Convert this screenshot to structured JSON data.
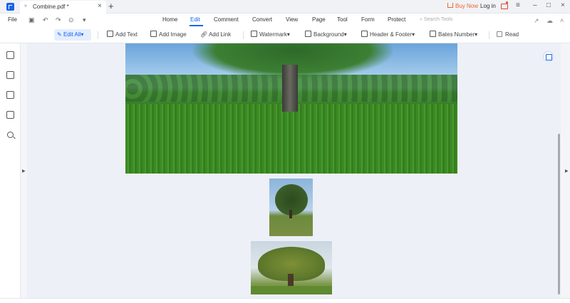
{
  "window": {
    "tab_title": "Combine.pdf *",
    "tab_arrow": "»",
    "tab_close": "×",
    "new_tab": "+",
    "buy_now": "Buy Now",
    "login": "Log in"
  },
  "menubar": {
    "file": "File",
    "items": [
      "Home",
      "Edit",
      "Comment",
      "Convert",
      "View",
      "Page",
      "Tool",
      "Form",
      "Protect"
    ],
    "active": "Edit",
    "search_placeholder": "Search Tools"
  },
  "toolbar": {
    "edit_all": "Edit All",
    "add_text": "Add Text",
    "add_image": "Add Image",
    "add_link": "Add Link",
    "watermark": "Watermark",
    "background": "Background",
    "header_footer": "Header & Footer",
    "bates_number": "Bates Number",
    "read": "Read"
  },
  "icons": {
    "sidebar": [
      "bookmark-icon",
      "pages-icon",
      "comment-icon",
      "attachment-icon",
      "search-icon"
    ]
  },
  "colors": {
    "accent": "#1464f0",
    "buy_now": "#f0672b"
  }
}
